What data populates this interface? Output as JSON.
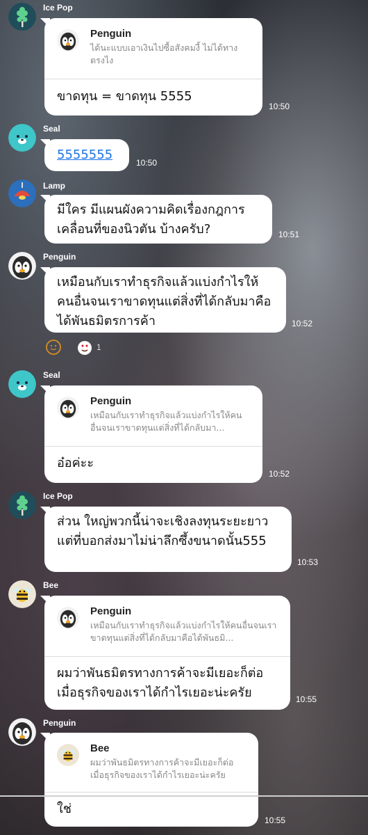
{
  "messages": [
    {
      "sender": "Ice Pop",
      "quote": {
        "name": "Penguin",
        "text": "ได้นะแบบเอาเงินไปซื้อสังคมงี้ ไม่ได้ทางตรงไง"
      },
      "text": "ขาดทุน = ขาดทุน 5555",
      "time": "10:50"
    },
    {
      "sender": "Seal",
      "text": "5555555",
      "time": "10:50"
    },
    {
      "sender": "Lamp",
      "text": "มีใคร มีแผนผังความคิดเรื่องกฎการเคลื่อนที่ของนิวตัน บ้างครับ?",
      "time": "10:51"
    },
    {
      "sender": "Penguin",
      "text": "เหมือนกับเราทำธุรกิจแล้วแบ่งกำไรให้คนอื่นจนเราขาดทุนแต่สิ่งที่ได้กลับมาคือได้พันธมิตรการค้า",
      "time": "10:52",
      "reaction_count": "1"
    },
    {
      "sender": "Seal",
      "quote": {
        "name": "Penguin",
        "text": "เหมือนกับเราทำธุรกิจแล้วแบ่งกำไรให้คนอื่นจนเราขาดทุนแต่สิ่งที่ได้กลับมา..."
      },
      "text": "อ๋อค่ะะ",
      "time": "10:52"
    },
    {
      "sender": "Ice Pop",
      "text": "ส่วน ใหญ่พวกนี้น่าจะเชิงลงทุนระยะยาว แต่ที่บอกส่งมาไม่น่าลึกซึ้งขนาดนั้น555",
      "time": "10:53"
    },
    {
      "sender": "Bee",
      "quote": {
        "name": "Penguin",
        "text": "เหมือนกับเราทำธุรกิจแล้วแบ่งกำไรให้คนอื่นจนเราขาดทุนแต่สิ่งที่ได้กลับมาคือได้พันธมิ..."
      },
      "text": "ผมว่าพันธมิตรทางการค้าจะมีเยอะก็ต่อเมื่อธุรกิจของเราได้กำไรเยอะน่ะครัย",
      "time": "10:55"
    },
    {
      "sender": "Penguin",
      "quote": {
        "name": "Bee",
        "text": "ผมว่าพันธมิตรทางการค้าจะมีเยอะก็ต่อเมื่อธุรกิจของเราได้กำไรเยอะน่ะครัย"
      },
      "text": "ใช่",
      "time": "10:55"
    }
  ],
  "colors": {
    "bubble": "#ffffff",
    "link": "#1a73e8",
    "icepop_bg": "#1f4d5a",
    "seal_bg": "#3ec6c9",
    "lamp_bg": "#2b6fbd",
    "penguin_bg": "#f2f2f2",
    "bee_bg": "#ede6d6"
  },
  "icons": {
    "icepop": "ice-pop-avatar-icon",
    "seal": "seal-avatar-icon",
    "lamp": "lamp-avatar-icon",
    "penguin": "penguin-avatar-icon",
    "bee": "bee-avatar-icon",
    "smile": "smile-reaction-icon",
    "heart_eyes": "heart-eyes-reaction-icon"
  }
}
